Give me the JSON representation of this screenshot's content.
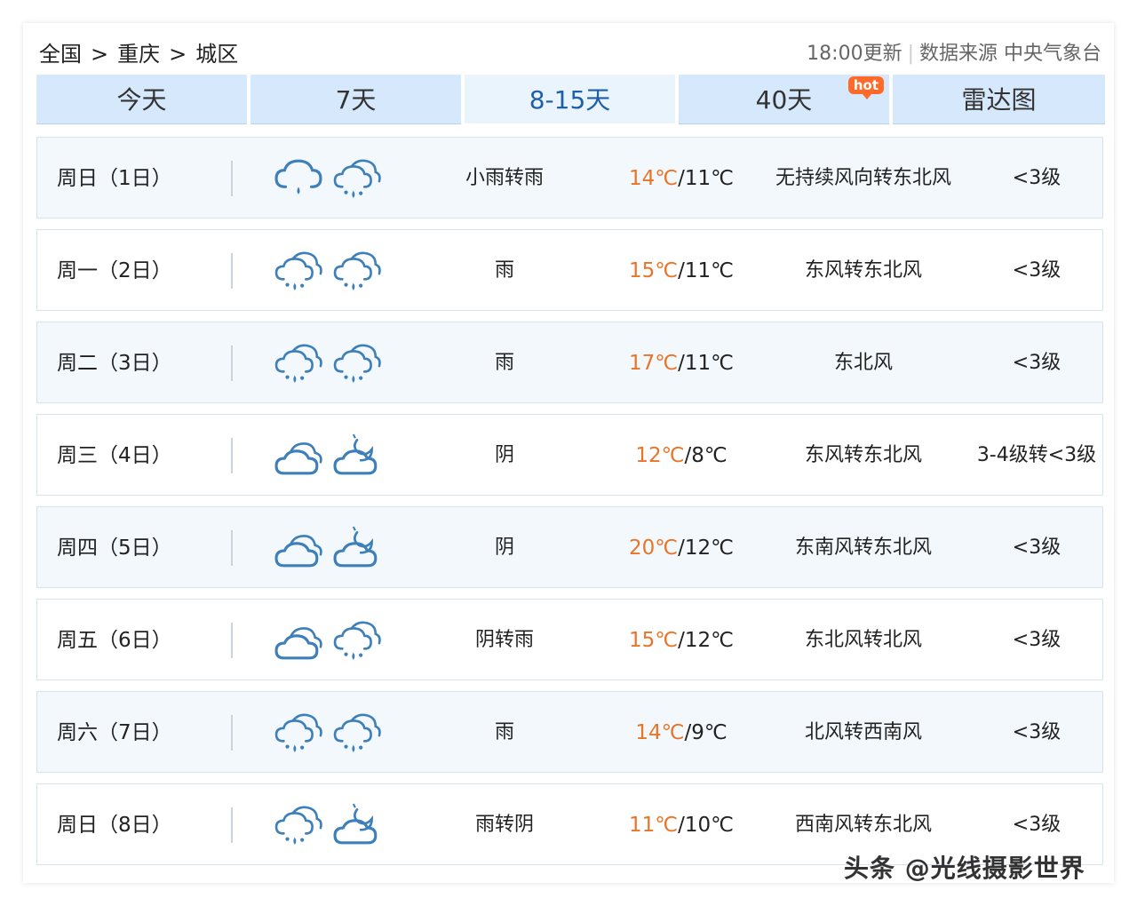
{
  "breadcrumb": {
    "items": [
      "全国",
      "重庆",
      "城区"
    ],
    "separator": ">"
  },
  "header_meta": {
    "update_time": "18:00更新",
    "source": "数据来源 中央气象台"
  },
  "tabs": [
    {
      "label": "今天",
      "active": false,
      "badge": ""
    },
    {
      "label": "7天",
      "active": false,
      "badge": ""
    },
    {
      "label": "8-15天",
      "active": true,
      "badge": ""
    },
    {
      "label": "40天",
      "active": false,
      "badge": "hot"
    },
    {
      "label": "雷达图",
      "active": false,
      "badge": ""
    }
  ],
  "forecast": [
    {
      "day": "周日（1日）",
      "icons": [
        "rain-cloud-icon",
        "drizzle-cloud-icon"
      ],
      "desc": "小雨转雨",
      "high": "14℃",
      "low": "11℃",
      "wind": "无持续风向转东北风",
      "level": "<3级"
    },
    {
      "day": "周一（2日）",
      "icons": [
        "drizzle-cloud-icon",
        "drizzle-cloud-icon"
      ],
      "desc": "雨",
      "high": "15℃",
      "low": "11℃",
      "wind": "东风转东北风",
      "level": "<3级"
    },
    {
      "day": "周二（3日）",
      "icons": [
        "drizzle-cloud-icon",
        "drizzle-cloud-icon"
      ],
      "desc": "雨",
      "high": "17℃",
      "low": "11℃",
      "wind": "东北风",
      "level": "<3级"
    },
    {
      "day": "周三（4日）",
      "icons": [
        "overcast-icon",
        "cloudy-night-icon"
      ],
      "desc": "阴",
      "high": "12℃",
      "low": "8℃",
      "wind": "东风转东北风",
      "level": "3-4级转<3级"
    },
    {
      "day": "周四（5日）",
      "icons": [
        "overcast-icon",
        "cloudy-night-icon"
      ],
      "desc": "阴",
      "high": "20℃",
      "low": "12℃",
      "wind": "东南风转东北风",
      "level": "<3级"
    },
    {
      "day": "周五（6日）",
      "icons": [
        "overcast-icon",
        "drizzle-cloud-icon"
      ],
      "desc": "阴转雨",
      "high": "15℃",
      "low": "12℃",
      "wind": "东北风转北风",
      "level": "<3级"
    },
    {
      "day": "周六（7日）",
      "icons": [
        "drizzle-cloud-icon",
        "drizzle-cloud-icon"
      ],
      "desc": "雨",
      "high": "14℃",
      "low": "9℃",
      "wind": "北风转西南风",
      "level": "<3级"
    },
    {
      "day": "周日（8日）",
      "icons": [
        "drizzle-cloud-icon",
        "cloudy-night-icon"
      ],
      "desc": "雨转阴",
      "high": "11℃",
      "low": "10℃",
      "wind": "西南风转东北风",
      "level": "<3级"
    }
  ],
  "watermark": "头条 @光线摄影世界",
  "colors": {
    "tab_bg": "#d6e8fb",
    "tab_active_text": "#1f5fa8",
    "high_temp": "#e87527",
    "icon_stroke": "#3d7fb8",
    "hot_badge": "#ff6a2b"
  }
}
